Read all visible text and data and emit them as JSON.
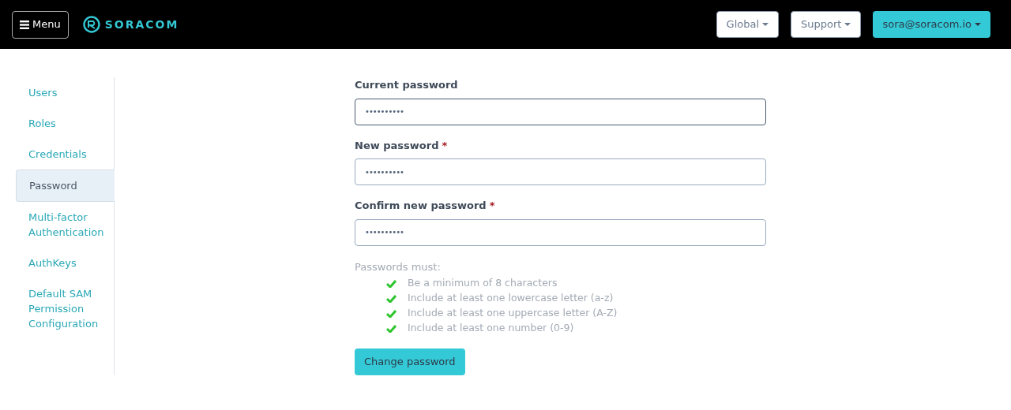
{
  "header": {
    "menu_button": "Menu",
    "logo": "SORACOM",
    "buttons": [
      {
        "label": "Global",
        "kind": "plain"
      },
      {
        "label": "Support",
        "kind": "plain"
      },
      {
        "label": "sora@soracom.io",
        "kind": "primary"
      }
    ]
  },
  "sidebar": {
    "items": [
      {
        "label": "Users",
        "selected": false
      },
      {
        "label": "Roles",
        "selected": false
      },
      {
        "label": "Credentials",
        "selected": false
      },
      {
        "label": "Password",
        "selected": true
      },
      {
        "label": "Multi-factor Authentication",
        "selected": false
      },
      {
        "label": "AuthKeys",
        "selected": false
      },
      {
        "label": "Default SAM Permission Configuration",
        "selected": false
      }
    ]
  },
  "form": {
    "fields": [
      {
        "label": "Current password",
        "focused": true,
        "value": "••••••••••"
      },
      {
        "label": "New password",
        "required_mark": "*",
        "focused": false,
        "value": "••••••••••"
      },
      {
        "label": "Confirm new password",
        "required_mark": "*",
        "focused": false,
        "value": "••••••••••"
      }
    ],
    "rules_title": "Passwords must:",
    "rules": [
      {
        "text": "Be a minimum of 8 characters",
        "met": true
      },
      {
        "text": "Include at least one lowercase letter (a-z)",
        "met": true
      },
      {
        "text": "Include at least one uppercase letter (A-Z)",
        "met": true
      },
      {
        "text": "Include at least one number (0-9)",
        "met": true
      }
    ],
    "submit": "Change password"
  }
}
